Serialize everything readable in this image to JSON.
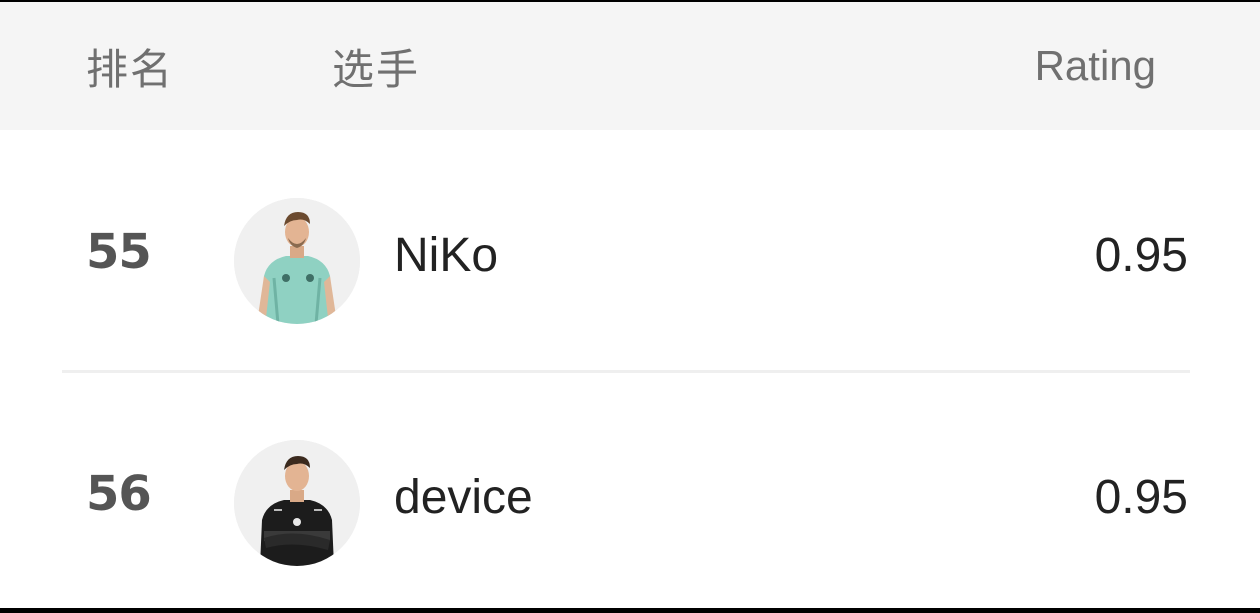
{
  "header": {
    "rank_label": "排名",
    "player_label": "选手",
    "rating_label": "Rating"
  },
  "rows": [
    {
      "rank": "55",
      "name": "NiKo",
      "rating": "0.95",
      "avatar_icon": "player-photo-niko",
      "jersey_color": "#8fd1c2"
    },
    {
      "rank": "56",
      "name": "device",
      "rating": "0.95",
      "avatar_icon": "player-photo-device",
      "jersey_color": "#1c1c1c"
    }
  ]
}
